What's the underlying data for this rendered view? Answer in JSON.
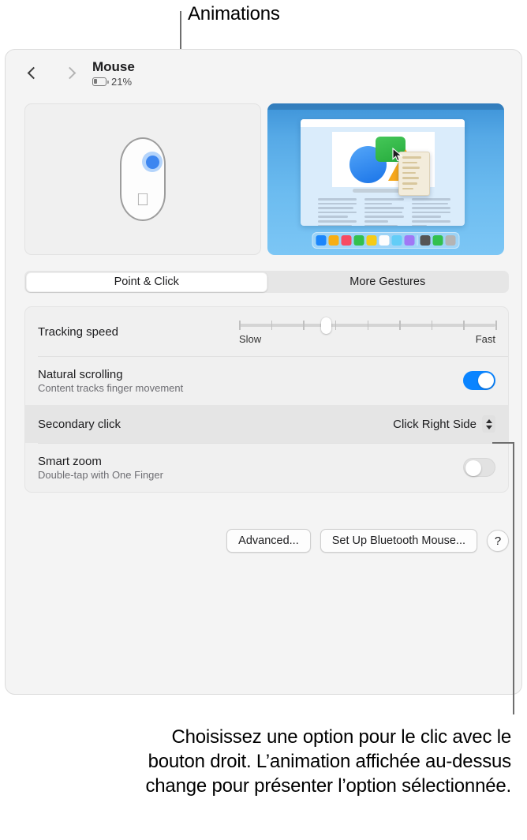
{
  "callouts": {
    "top_label": "Animations",
    "bottom_caption": "Choisissez une option pour le clic avec le bouton droit. L’animation affichée au-dessus change pour présenter l’option sélectionnée."
  },
  "window": {
    "title": "Mouse",
    "battery_percent": "21%",
    "nav": {
      "back": "‹",
      "forward": "›"
    }
  },
  "preview": {
    "left_panel_name": "mouse-animation",
    "right_panel_name": "desktop-animation",
    "dock_colors": [
      "#1b86fb",
      "#f7ae14",
      "#f74a62",
      "#32c04e",
      "#f5cb16",
      "#fdfdfd",
      "#63cdf7",
      "#a078f5",
      "#555555",
      "#32c04e",
      "#b4b4b4"
    ]
  },
  "tabs": [
    {
      "label": "Point & Click",
      "selected": true
    },
    {
      "label": "More Gestures",
      "selected": false
    }
  ],
  "settings": {
    "tracking_speed": {
      "label": "Tracking speed",
      "slow_label": "Slow",
      "fast_label": "Fast",
      "ticks": 9,
      "value_index": 3
    },
    "natural_scrolling": {
      "label": "Natural scrolling",
      "sublabel": "Content tracks finger movement",
      "state": "on"
    },
    "secondary_click": {
      "label": "Secondary click",
      "value": "Click Right Side",
      "highlighted": true
    },
    "smart_zoom": {
      "label": "Smart zoom",
      "sublabel": "Double-tap with One Finger",
      "state": "off"
    }
  },
  "footer": {
    "advanced": "Advanced...",
    "setup_bluetooth": "Set Up Bluetooth Mouse...",
    "help": "?"
  },
  "colors": {
    "accent": "#0a84ff",
    "window_bg": "#f4f4f4",
    "group_bg": "#f0f0f0",
    "highlight_row": "#e5e5e5",
    "leader_line": "#6e6e6e"
  }
}
